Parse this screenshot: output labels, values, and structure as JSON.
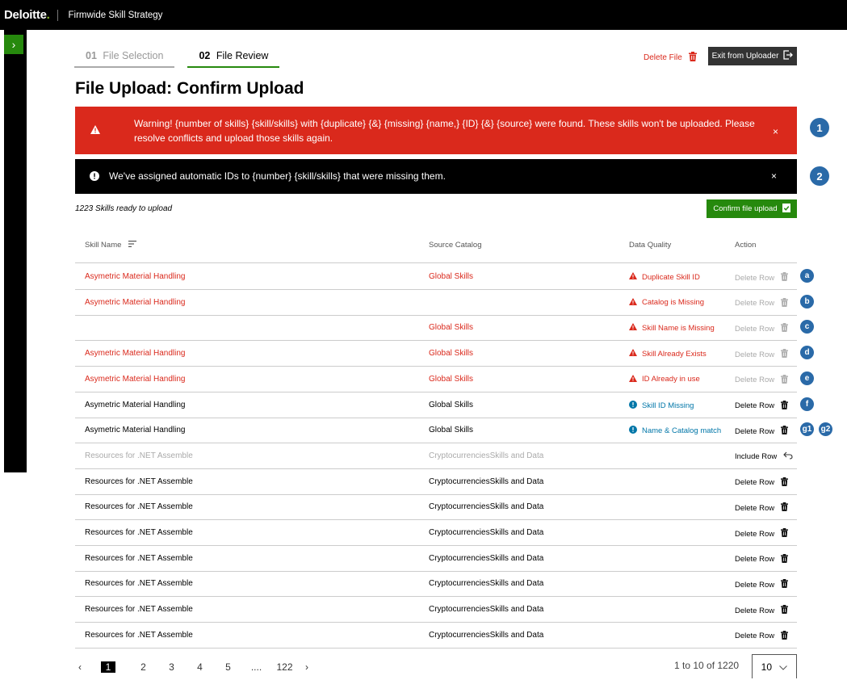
{
  "header": {
    "logo_text": "Deloitte",
    "logo_dot": ".",
    "app_title": "Firmwide Skill Strategy"
  },
  "sidebar": {
    "toggle_icon": "chevron-right-icon",
    "toggle_glyph": "›"
  },
  "steps": [
    {
      "num": "01",
      "label": "File Selection",
      "active": false
    },
    {
      "num": "02",
      "label": "File Review",
      "active": true
    }
  ],
  "actions": {
    "delete_file_label": "Delete File",
    "exit_label": "Exit from Uploader"
  },
  "page_title": "File Upload: Confirm Upload",
  "alerts": {
    "warning": {
      "text": "Warning! {number of skills} {skill/skills} with {duplicate} {&} {missing} {name,} {ID} {&} {source} were found. These skills won't be uploaded. Please resolve conflicts and upload those skills again.",
      "close": "×",
      "marker": "1"
    },
    "info": {
      "text": "We've assigned automatic IDs to {number} {skill/skills} that were missing them.",
      "close": "×",
      "marker": "2"
    }
  },
  "summary": {
    "ready_text": "1223 Skills ready to upload",
    "confirm_label": "Confirm file upload"
  },
  "table": {
    "headers": {
      "skill_name": "Skill Name",
      "source_catalog": "Source Catalog",
      "data_quality": "Data Quality",
      "action": "Action"
    },
    "rows": [
      {
        "skill": "Asymetric Material Handling",
        "catalog": "Global Skills",
        "dq": "Duplicate Skill ID",
        "dq_type": "error",
        "action": "Delete Row",
        "state": "error",
        "markers": [
          "a"
        ]
      },
      {
        "skill": "Asymetric Material Handling",
        "catalog": "",
        "dq": "Catalog is Missing",
        "dq_type": "error",
        "action": "Delete Row",
        "state": "error",
        "markers": [
          "b"
        ]
      },
      {
        "skill": "",
        "catalog": "Global Skills",
        "dq": "Skill Name is Missing",
        "dq_type": "error",
        "action": "Delete Row",
        "state": "error",
        "markers": [
          "c"
        ]
      },
      {
        "skill": "Asymetric Material Handling",
        "catalog": "Global Skills",
        "dq": "Skill Already Exists",
        "dq_type": "error",
        "action": "Delete Row",
        "state": "error",
        "markers": [
          "d"
        ]
      },
      {
        "skill": "Asymetric Material Handling",
        "catalog": "Global Skills",
        "dq": "ID Already in use",
        "dq_type": "error",
        "action": "Delete Row",
        "state": "error",
        "markers": [
          "e"
        ]
      },
      {
        "skill": "Asymetric Material Handling",
        "catalog": "Global Skills",
        "dq": "Skill ID Missing",
        "dq_type": "info",
        "action": "Delete Row",
        "state": "normal",
        "markers": [
          "f"
        ]
      },
      {
        "skill": "Asymetric Material Handling",
        "catalog": "Global Skills",
        "dq": "Name & Catalog match",
        "dq_type": "info",
        "action": "Delete Row",
        "state": "normal",
        "markers": [
          "g1",
          "g2"
        ]
      },
      {
        "skill": "Resources for .NET Assemble",
        "catalog": "CryptocurrenciesSkills and Data",
        "dq": "",
        "dq_type": "none",
        "action": "Include Row",
        "state": "excluded",
        "markers": []
      },
      {
        "skill": "Resources for .NET Assemble",
        "catalog": "CryptocurrenciesSkills and Data",
        "dq": "",
        "dq_type": "none",
        "action": "Delete Row",
        "state": "normal",
        "markers": []
      },
      {
        "skill": "Resources for .NET Assemble",
        "catalog": "CryptocurrenciesSkills and Data",
        "dq": "",
        "dq_type": "none",
        "action": "Delete Row",
        "state": "normal",
        "markers": []
      },
      {
        "skill": "Resources for .NET Assemble",
        "catalog": "CryptocurrenciesSkills and Data",
        "dq": "",
        "dq_type": "none",
        "action": "Delete Row",
        "state": "normal",
        "markers": []
      },
      {
        "skill": "Resources for .NET Assemble",
        "catalog": "CryptocurrenciesSkills and Data",
        "dq": "",
        "dq_type": "none",
        "action": "Delete Row",
        "state": "normal",
        "markers": []
      },
      {
        "skill": "Resources for .NET Assemble",
        "catalog": "CryptocurrenciesSkills and Data",
        "dq": "",
        "dq_type": "none",
        "action": "Delete Row",
        "state": "normal",
        "markers": []
      },
      {
        "skill": "Resources for .NET Assemble",
        "catalog": "CryptocurrenciesSkills and Data",
        "dq": "",
        "dq_type": "none",
        "action": "Delete Row",
        "state": "normal",
        "markers": []
      },
      {
        "skill": "Resources for .NET Assemble",
        "catalog": "CryptocurrenciesSkills and Data",
        "dq": "",
        "dq_type": "none",
        "action": "Delete Row",
        "state": "normal",
        "markers": []
      }
    ]
  },
  "pagination": {
    "prev": "‹",
    "next": "›",
    "pages": [
      "1",
      "2",
      "3",
      "4",
      "5",
      "....",
      "122"
    ],
    "current": "1",
    "info": "1 to 10 of 1220",
    "page_size": "10"
  },
  "colors": {
    "brand_green": "#86bc25",
    "action_green": "#26890d",
    "error_red": "#da291c",
    "info_blue": "#0076a8",
    "marker_blue": "#2a6aa8"
  }
}
